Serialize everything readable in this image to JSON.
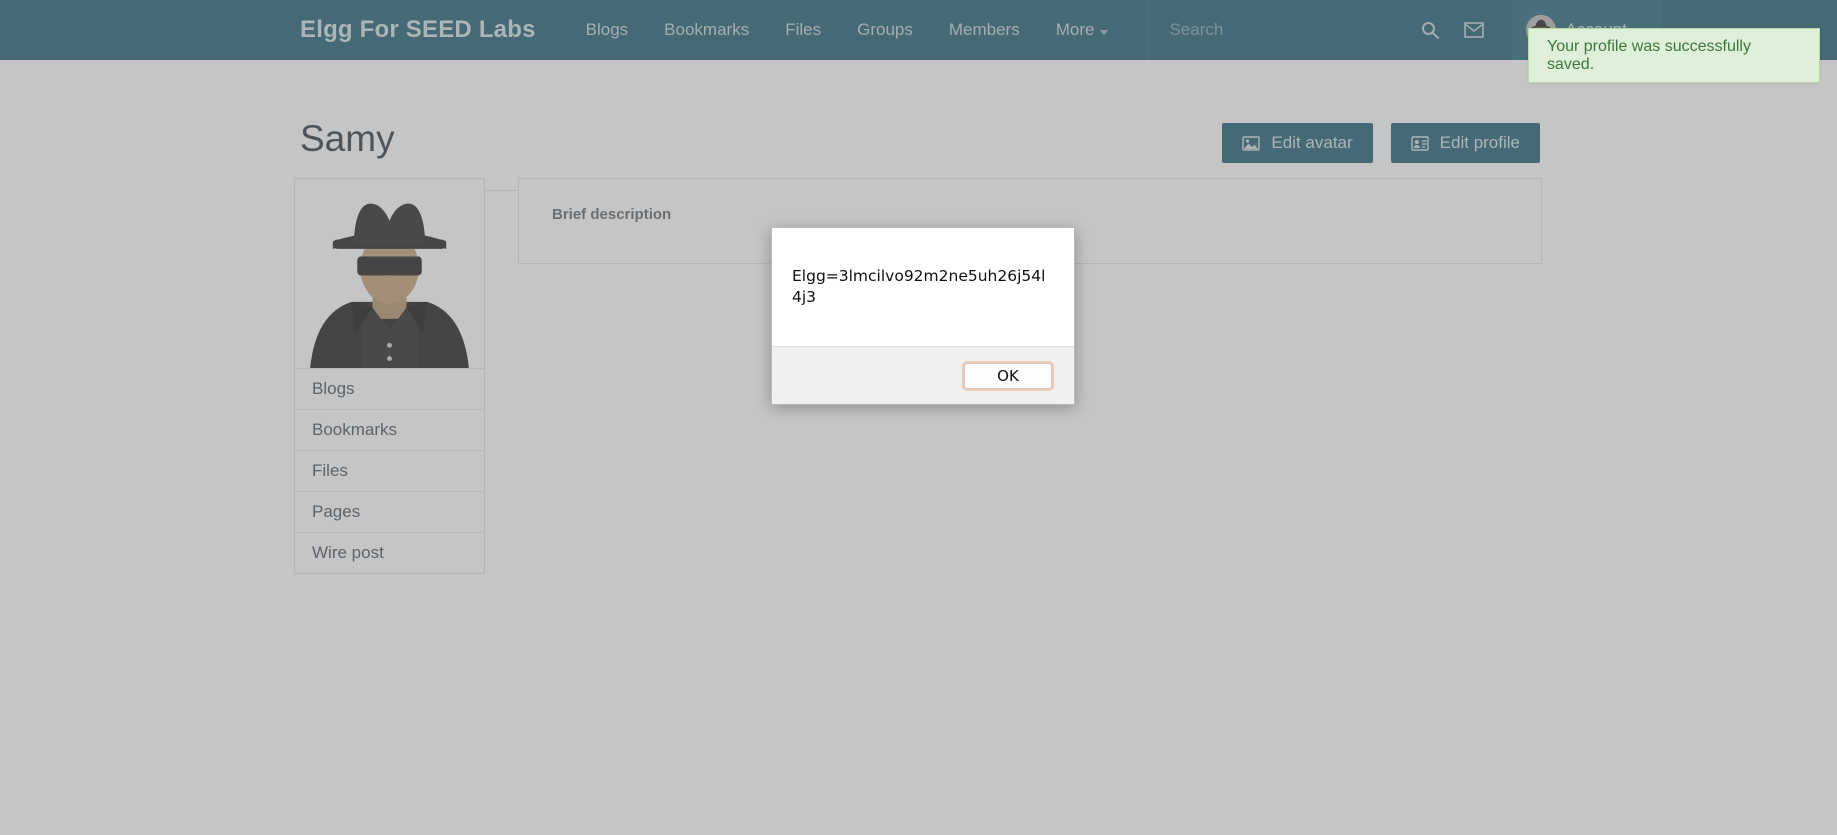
{
  "site": {
    "brand": "Elgg For SEED Labs",
    "theme_color": "#14556b",
    "accent_color": "#1a6075"
  },
  "nav": {
    "items": [
      {
        "label": "Blogs",
        "has_caret": false
      },
      {
        "label": "Bookmarks",
        "has_caret": false
      },
      {
        "label": "Files",
        "has_caret": false
      },
      {
        "label": "Groups",
        "has_caret": false
      },
      {
        "label": "Members",
        "has_caret": false
      },
      {
        "label": "More",
        "has_caret": true
      }
    ],
    "search": {
      "placeholder": "Search",
      "value": ""
    },
    "search_icon": "search-icon",
    "messages_icon": "envelope-icon",
    "account": {
      "label": "Account",
      "has_caret": true,
      "avatar": "spy-avatar"
    }
  },
  "toast": {
    "message": "Your profile was successfully saved.",
    "type": "success",
    "text_color": "#3c763d",
    "bg_color": "#dff0d8"
  },
  "page": {
    "title": "Samy",
    "actions": [
      {
        "label": "Edit avatar",
        "icon": "image-icon"
      },
      {
        "label": "Edit profile",
        "icon": "id-card-icon"
      }
    ]
  },
  "sidebar": {
    "avatar": "spy-avatar",
    "items": [
      {
        "label": "Blogs"
      },
      {
        "label": "Bookmarks"
      },
      {
        "label": "Files"
      },
      {
        "label": "Pages"
      },
      {
        "label": "Wire post"
      }
    ]
  },
  "profile": {
    "brief_description_label": "Brief description",
    "brief_description_value": ""
  },
  "alert_dialog": {
    "message": "Elgg=3lmcilvo92m2ne5uh26j54l4j3",
    "ok_label": "OK"
  }
}
